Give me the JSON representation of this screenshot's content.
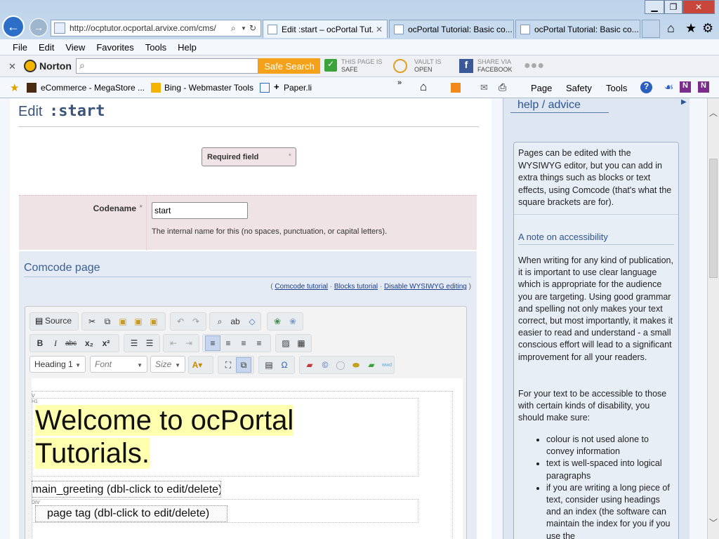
{
  "browser": {
    "address": "http://ocptutor.ocportal.arvixe.com/cms/",
    "tabs": [
      {
        "title": "Edit :start – ocPortal Tut...",
        "close": "✕"
      },
      {
        "title": "ocPortal Tutorial: Basic co..."
      },
      {
        "title": "ocPortal Tutorial: Basic co..."
      }
    ],
    "menu": [
      "File",
      "Edit",
      "View",
      "Favorites",
      "Tools",
      "Help"
    ],
    "norton": {
      "brand": "Norton",
      "search_button": "Safe Search",
      "page_status_line1": "THIS PAGE IS",
      "page_status_line2": "SAFE",
      "vault_line1": "VAULT IS",
      "vault_line2": "OPEN",
      "share_line1": "SHARE VIA",
      "share_line2": "FACEBOOK"
    },
    "favorites": [
      {
        "label": "eCommerce - MegaStore ..."
      },
      {
        "label": "Bing - Webmaster Tools"
      },
      {
        "label": "Paper.li"
      }
    ],
    "command_bar": [
      "Page",
      "Safety",
      "Tools"
    ]
  },
  "edit": {
    "title_prefix": "Edit",
    "title_code": ":start",
    "required_label": "Required field",
    "required_star": "*",
    "codename_label": "Codename",
    "codename_star": "*",
    "codename_value": "start",
    "codename_hint": "The internal name for this (no spaces, punctuation, or capital letters).",
    "section_title": "Comcode page",
    "links": {
      "comcode_tutorial": "Comcode tutorial",
      "blocks_tutorial": "Blocks tutorial",
      "disable_wysiwyg": "Disable WYSIWYG editing"
    },
    "toolbar": {
      "source": "Source",
      "format": "Heading 1",
      "font": "Font",
      "size": "Size"
    },
    "editor": {
      "marker_v": "V",
      "marker_h1": "H1",
      "marker_div": "DIV",
      "heading": "Welcome to ocPortal Tutorials.",
      "block_label": "main_greeting (dbl-click to edit/delete)",
      "page_tag_label": "page tag (dbl-click to edit/delete)"
    }
  },
  "sidebar": {
    "title": "help / advice",
    "intro": "Pages can be edited with the WYSIWYG editor, but you can add in extra things such as blocks or text effects, using Comcode (that's what the square brackets are for).",
    "accessibility_heading": "A note on accessibility",
    "para1": "When writing for any kind of publication, it is important to use clear language which is appropriate for the audience you are targeting. Using good grammar and spelling not only makes your text correct, but most importantly, it makes it easier to read and understand - a small conscious effort will lead to a significant improvement for all your readers.",
    "para2": "For your text to be accessible to those with certain kinds of disability, you should make sure:",
    "bullets": [
      "colour is not used alone to convey information",
      "text is well-spaced into logical paragraphs",
      "if you are writing a long piece of text, consider using headings and an index (the software can maintain the index for you if you use the"
    ]
  }
}
